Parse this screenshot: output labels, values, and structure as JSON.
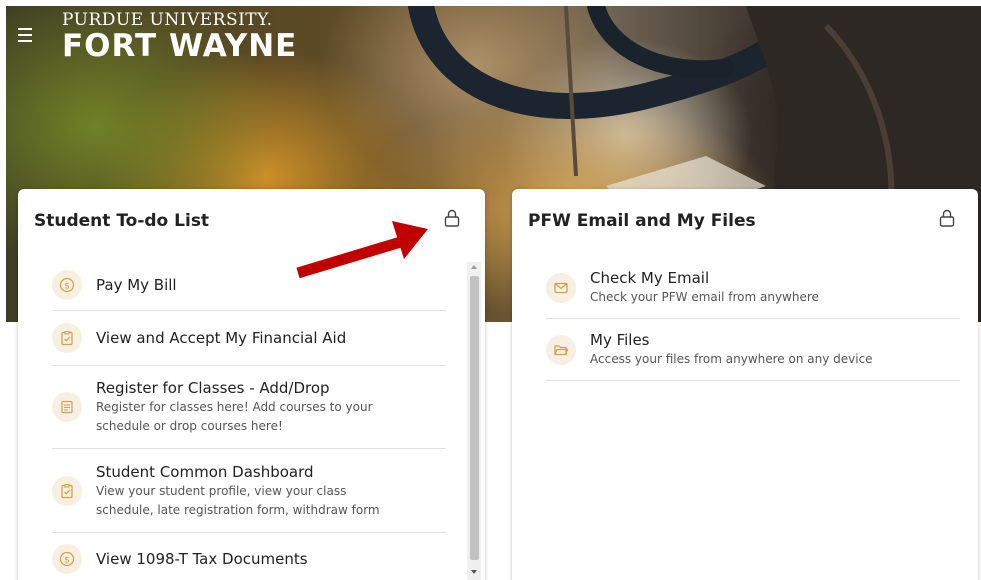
{
  "header": {
    "logo_line1": "PURDUE UNIVERSITY.",
    "logo_line2": "FORT WAYNE"
  },
  "todo_card": {
    "title": "Student To-do List",
    "items": [
      {
        "title": "Pay My Bill",
        "description": "",
        "icon": "dollar-circle-icon"
      },
      {
        "title": "View and Accept My Financial Aid",
        "description": "",
        "icon": "clipboard-check-icon"
      },
      {
        "title": "Register for Classes - Add/Drop",
        "description_line1": "Register for classes here! Add courses to your",
        "description_line2": "schedule or drop courses here!",
        "icon": "document-icon"
      },
      {
        "title": "Student Common Dashboard",
        "description_line1": "View your student profile, view your class",
        "description_line2": "schedule, late registration form, withdraw form",
        "icon": "clipboard-check-icon"
      },
      {
        "title": "View 1098-T Tax Documents",
        "description": "",
        "icon": "dollar-circle-icon"
      }
    ]
  },
  "email_card": {
    "title": "PFW Email and My Files",
    "items": [
      {
        "title": "Check My Email",
        "description": "Check your PFW email from anywhere",
        "icon": "envelope-icon"
      },
      {
        "title": "My Files",
        "description": "Access your files from anywhere on any device",
        "icon": "folder-open-icon"
      }
    ]
  },
  "colors": {
    "icon_bg": "#f7efe2",
    "icon_fg": "#c9a24a",
    "annotation_arrow": "#c00000"
  }
}
